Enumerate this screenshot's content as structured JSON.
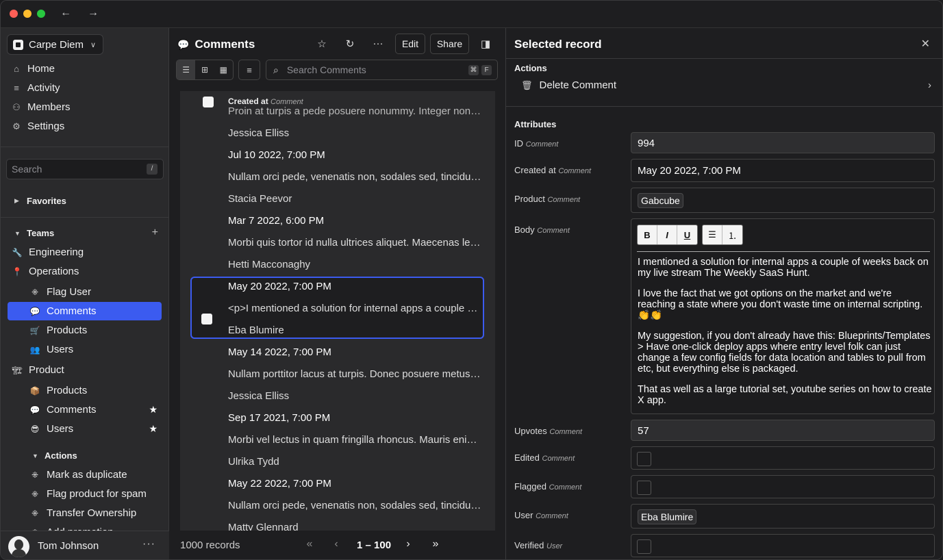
{
  "titlebar": {
    "back": "←",
    "forward": "→"
  },
  "sidebar": {
    "workspace": "Carpe Diem",
    "nav": [
      {
        "label": "Home",
        "icon": "⌂"
      },
      {
        "label": "Activity",
        "icon": "≡"
      },
      {
        "label": "Members",
        "icon": "⚇"
      },
      {
        "label": "Settings",
        "icon": "⚙"
      }
    ],
    "search_placeholder": "Search",
    "search_kbd": "/",
    "favorites_label": "Favorites",
    "teams_label": "Teams",
    "teams": [
      {
        "label": "Engineering",
        "icon": "🔧"
      },
      {
        "label": "Operations",
        "icon": "📍"
      }
    ],
    "operations_items": [
      {
        "label": "Flag User",
        "icon": "⁜"
      },
      {
        "label": "Comments",
        "icon": "💬"
      },
      {
        "label": "Products",
        "icon": "🛒"
      },
      {
        "label": "Users",
        "icon": "👥"
      }
    ],
    "product_label": "Product",
    "product_icon": "🏗",
    "product_items": [
      {
        "label": "Products",
        "icon": "📦"
      },
      {
        "label": "Comments",
        "icon": "💬",
        "starred": "★"
      },
      {
        "label": "Users",
        "icon": "😎",
        "starred": "★"
      }
    ],
    "actions_label": "Actions",
    "actions": [
      {
        "label": "Mark as duplicate"
      },
      {
        "label": "Flag product for spam"
      },
      {
        "label": "Transfer Ownership"
      },
      {
        "label": "Add promotion"
      }
    ],
    "user_name": "Tom Johnson",
    "user_menu": "···"
  },
  "middle": {
    "title": "Comments",
    "edit_label": "Edit",
    "share_label": "Share",
    "search_placeholder": "Search Comments",
    "search_kbd1": "⌘",
    "search_kbd2": "F",
    "header_label": "Created at",
    "header_type": "Comment",
    "rows": [
      {
        "text": "Proin at turpis a pede posuere nonummy. Integer non velit.",
        "kind": "faded"
      },
      {
        "text": "Jessica Elliss",
        "kind": "text"
      },
      {
        "text": "Jul 10 2022, 7:00 PM",
        "kind": "date"
      },
      {
        "text": "Nullam orci pede, venenatis non, sodales sed, tincidunt eu, felis.",
        "kind": "text"
      },
      {
        "text": "Stacia Peevor",
        "kind": "text"
      },
      {
        "text": "Mar 7 2022, 6:00 PM",
        "kind": "date"
      },
      {
        "text": "Morbi quis tortor id nulla ultrices aliquet. Maecenas leo odio.",
        "kind": "text"
      },
      {
        "text": "Hetti Macconaghy",
        "kind": "text"
      },
      {
        "text": "May 20 2022, 7:00 PM",
        "kind": "date"
      },
      {
        "text": "<p>I mentioned a solution for internal apps a couple of weeks back",
        "kind": "text"
      },
      {
        "text": "Eba Blumire",
        "kind": "text"
      },
      {
        "text": "May 14 2022, 7:00 PM",
        "kind": "date"
      },
      {
        "text": "Nullam porttitor lacus at turpis. Donec posuere metus vitae ipsum.",
        "kind": "text"
      },
      {
        "text": "Jessica Elliss",
        "kind": "text"
      },
      {
        "text": "Sep 17 2021, 7:00 PM",
        "kind": "date"
      },
      {
        "text": "Morbi vel lectus in quam fringilla rhoncus. Mauris enim leo.",
        "kind": "text"
      },
      {
        "text": "Ulrika Tydd",
        "kind": "text"
      },
      {
        "text": "May 22 2022, 7:00 PM",
        "kind": "date"
      },
      {
        "text": "Nullam orci pede, venenatis non, sodales sed, tincidunt eu, felis.",
        "kind": "text"
      },
      {
        "text": "Matty Glennard",
        "kind": "text"
      }
    ],
    "records_label": "1000 records",
    "page_label": "1 – 100"
  },
  "right": {
    "title": "Selected record",
    "actions_label": "Actions",
    "delete_label": "Delete Comment",
    "attributes_label": "Attributes",
    "fields": {
      "id": {
        "label": "ID",
        "type": "Comment",
        "value": "994"
      },
      "created": {
        "label": "Created at",
        "type": "Comment",
        "value": "May 20 2022, 7:00 PM"
      },
      "product": {
        "label": "Product",
        "type": "Comment",
        "value": "Gabcube"
      },
      "body": {
        "label": "Body",
        "type": "Comment"
      },
      "upvotes": {
        "label": "Upvotes",
        "type": "Comment",
        "value": "57"
      },
      "edited": {
        "label": "Edited",
        "type": "Comment"
      },
      "flagged": {
        "label": "Flagged",
        "type": "Comment"
      },
      "user": {
        "label": "User",
        "type": "Comment",
        "value": "Eba Blumire"
      },
      "verified": {
        "label": "Verified",
        "type": "User"
      }
    },
    "body_paragraphs": [
      "I mentioned a solution for internal apps a couple of weeks back on my live stream The Weekly SaaS Hunt.",
      "I love the fact that we got options on the market and we're reaching a state where you don't waste time on internal scripting. 👏👏",
      "My suggestion, if you don't already have this: Blueprints/Templates > Have one-click deploy apps where entry level folk can just change a few config fields for data location and tables to pull from etc, but everything else is packaged.",
      "That as well as a large tutorial set, youtube series on how to create X app."
    ],
    "toolbar": {
      "bold": "B",
      "italic": "I",
      "underline": "U",
      "bullets": "☰",
      "numbers": "⒈"
    }
  }
}
